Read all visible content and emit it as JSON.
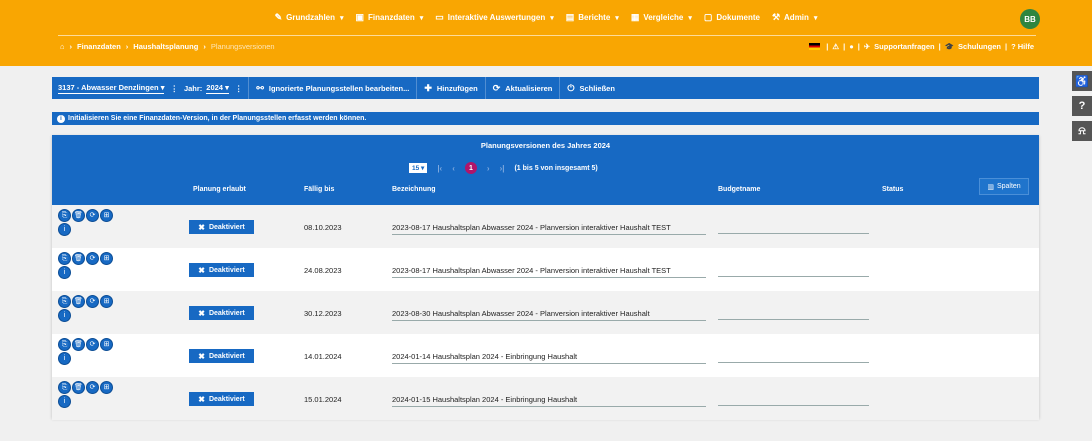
{
  "nav": {
    "items": [
      {
        "icon": "edit-icon",
        "glyph": "✎",
        "label": "Grundzahlen"
      },
      {
        "icon": "money-icon",
        "glyph": "▣",
        "label": "Finanzdaten"
      },
      {
        "icon": "monitor-icon",
        "glyph": "▭",
        "label": "Interaktive Auswertungen"
      },
      {
        "icon": "book-icon",
        "glyph": "▤",
        "label": "Berichte"
      },
      {
        "icon": "table-icon",
        "glyph": "▦",
        "label": "Vergleiche"
      },
      {
        "icon": "folder-icon",
        "glyph": "▢",
        "label": "Dokumente"
      },
      {
        "icon": "wrench-icon",
        "glyph": "⚒",
        "label": "Admin"
      }
    ],
    "avatar": "BB"
  },
  "breadcrumb": {
    "home": "⌂",
    "items": [
      "Finanzdaten",
      "Haushaltsplanung",
      "Planungsversionen"
    ]
  },
  "rightlinks": {
    "warning": "⚠",
    "chat": "●",
    "support": "Supportanfragen",
    "schulungen": "Schulungen",
    "hilfe": "? Hilfe"
  },
  "toolbar": {
    "unit": "3137 - Abwasser Denzlingen",
    "year_label": "Jahr:",
    "year": "2024",
    "ignored": "Ignorierte Planungsstellen bearbeiten...",
    "add": "Hinzufügen",
    "refresh": "Aktualisieren",
    "close": "Schließen"
  },
  "info": {
    "text": "Initialisieren Sie eine Finanzdaten-Version, in der Planungsstellen erfasst werden können."
  },
  "panel": {
    "title": "Planungsversionen des Jahres 2024",
    "page_size": "15",
    "current_page": "1",
    "range": "(1 bis 5 von insgesamt 5)",
    "columns_button": "Spalten",
    "headers": {
      "planung": "Planung erlaubt",
      "faellig": "Fällig bis",
      "bezeichnung": "Bezeichnung",
      "budget": "Budgetname",
      "status": "Status"
    }
  },
  "rows": [
    {
      "button": "Deaktiviert",
      "due": "08.10.2023",
      "name": "2023-08-17 Haushaltsplan Abwasser 2024 - Planversion interaktiver Haushalt TEST",
      "budget": "",
      "status": ""
    },
    {
      "button": "Deaktiviert",
      "due": "24.08.2023",
      "name": "2023-08-17 Haushaltsplan Abwasser 2024 - Planversion interaktiver Haushalt TEST",
      "budget": "",
      "status": ""
    },
    {
      "button": "Deaktiviert",
      "due": "30.12.2023",
      "name": "2023-08-30 Haushaltsplan Abwasser 2024 - Planversion interaktiver Haushalt",
      "budget": "",
      "status": ""
    },
    {
      "button": "Deaktiviert",
      "due": "14.01.2024",
      "name": "2024-01-14 Haushaltsplan 2024 - Einbringung Haushalt",
      "budget": "",
      "status": ""
    },
    {
      "button": "Deaktiviert",
      "due": "15.01.2024",
      "name": "2024-01-15 Haushaltsplan 2024 - Einbringung Haushalt",
      "budget": "",
      "status": ""
    }
  ]
}
